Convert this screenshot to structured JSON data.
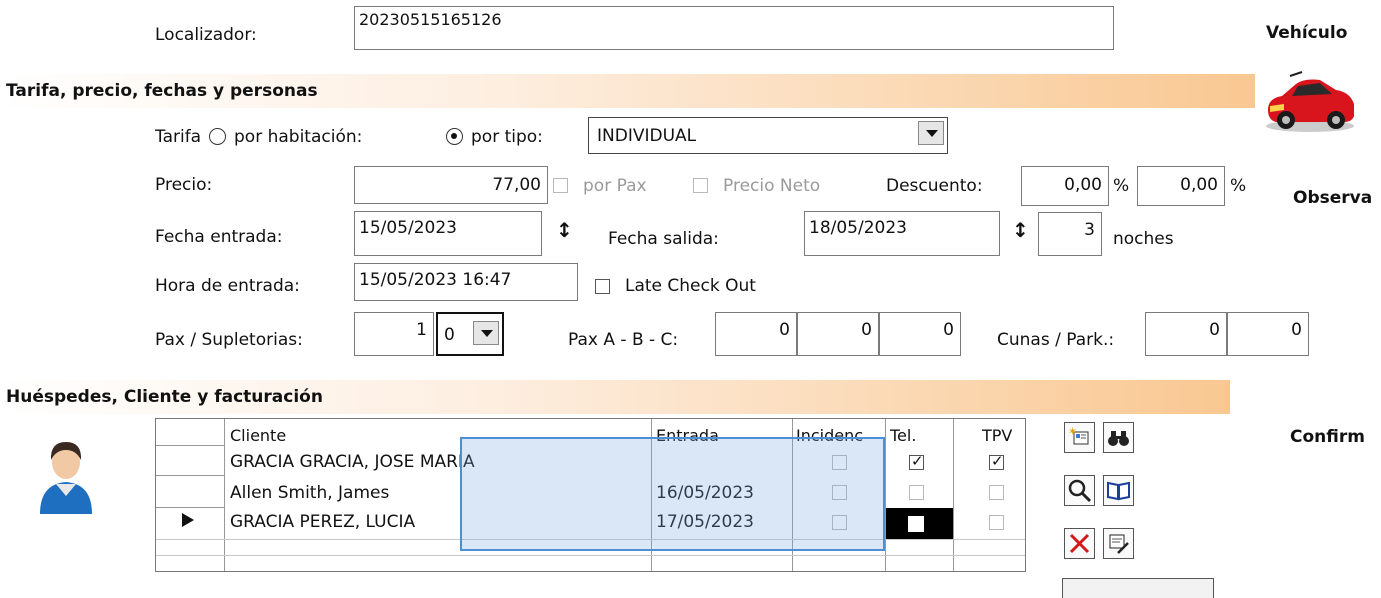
{
  "header": {
    "localizador_label": "Localizador:",
    "localizador_value": "20230515165126",
    "vehiculo_label": "Vehículo"
  },
  "section_tarifa": {
    "title": "Tarifa, precio, fechas y personas",
    "tarifa_label": "Tarifa",
    "radio_habitacion_label": "por habitación:",
    "radio_tipo_label": "por tipo:",
    "tipo_selected": "INDIVIDUAL",
    "precio_label": "Precio:",
    "precio_value": "77,00",
    "por_pax_label": "por Pax",
    "precio_neto_label": "Precio Neto",
    "descuento_label": "Descuento:",
    "descuento1_value": "0,00",
    "descuento2_value": "0,00",
    "percent": "%",
    "observ_label": "Observa",
    "fecha_entrada_label": "Fecha entrada:",
    "fecha_entrada_value": "15/05/2023",
    "fecha_salida_label": "Fecha salida:",
    "fecha_salida_value": "18/05/2023",
    "noches_value": "3",
    "noches_label": "noches",
    "hora_entrada_label": "Hora de entrada:",
    "hora_entrada_value": "15/05/2023 16:47",
    "late_checkout_label": "Late Check Out",
    "pax_label": "Pax / Supletorias:",
    "pax_value": "1",
    "supletorias_selected": "0",
    "pax_abc_label": "Pax A - B - C:",
    "pax_a": "0",
    "pax_b": "0",
    "pax_c": "0",
    "cunas_label": "Cunas / Park.:",
    "cunas_value": "0",
    "park_value": "0"
  },
  "section_huespedes": {
    "title": "Huéspedes, Cliente y facturación",
    "confirm_label": "Confirm",
    "columns": [
      "Cliente",
      "Entrada",
      "Incidenc",
      "Tel.",
      "TPV"
    ],
    "rows": [
      {
        "cliente": "GRACIA GRACIA, JOSE MARIA",
        "entrada": "",
        "incidencia": false,
        "tel": true,
        "tpv": true
      },
      {
        "cliente": "Allen Smith, James",
        "entrada": "16/05/2023",
        "incidencia": false,
        "tel": false,
        "tpv": false
      },
      {
        "cliente": "GRACIA PEREZ, LUCIA",
        "entrada": "17/05/2023",
        "incidencia": false,
        "tel": false,
        "tpv": false
      }
    ],
    "current_row_index": 2
  },
  "colors": {
    "section_gradient_end": "#f9c892",
    "selection_border": "#4a8fd8",
    "selection_fill": "#cfe3f7"
  },
  "icons": [
    "car-icon",
    "user-avatar-icon",
    "new-client-icon",
    "binoculars-icon",
    "magnifier-icon",
    "book-icon",
    "delete-icon",
    "edit-icon"
  ]
}
